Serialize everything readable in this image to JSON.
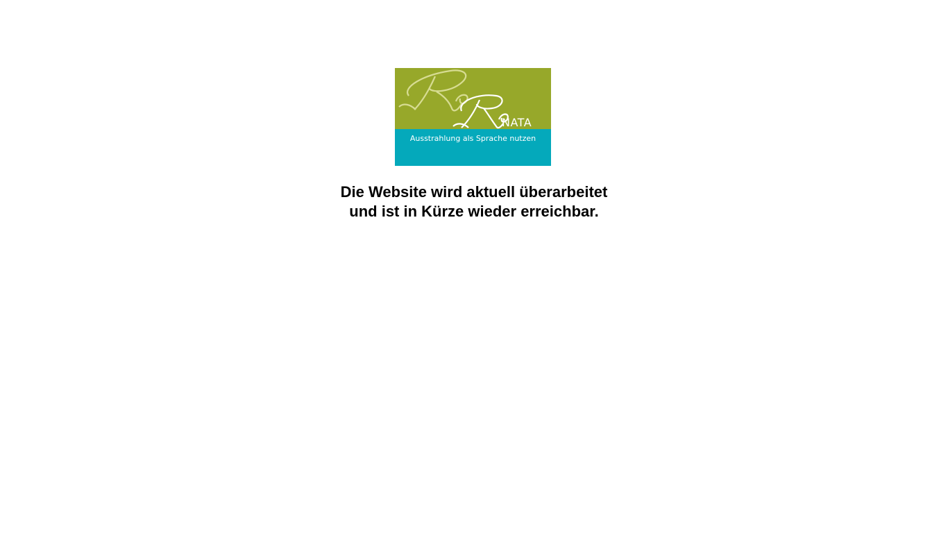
{
  "logo": {
    "script_letters": "ReRe",
    "brand_suffix": "NATA",
    "tagline": "Ausstrahlung als Sprache nutzen",
    "colors": {
      "top_band": "#97a82a",
      "bottom_band": "#04a9bb",
      "script_light": "#dfe2a0",
      "script_white": "#ffffff"
    }
  },
  "message": {
    "line1": "Die Website wird aktuell überarbeitet",
    "line2": "und ist in Kürze wieder erreichbar."
  }
}
